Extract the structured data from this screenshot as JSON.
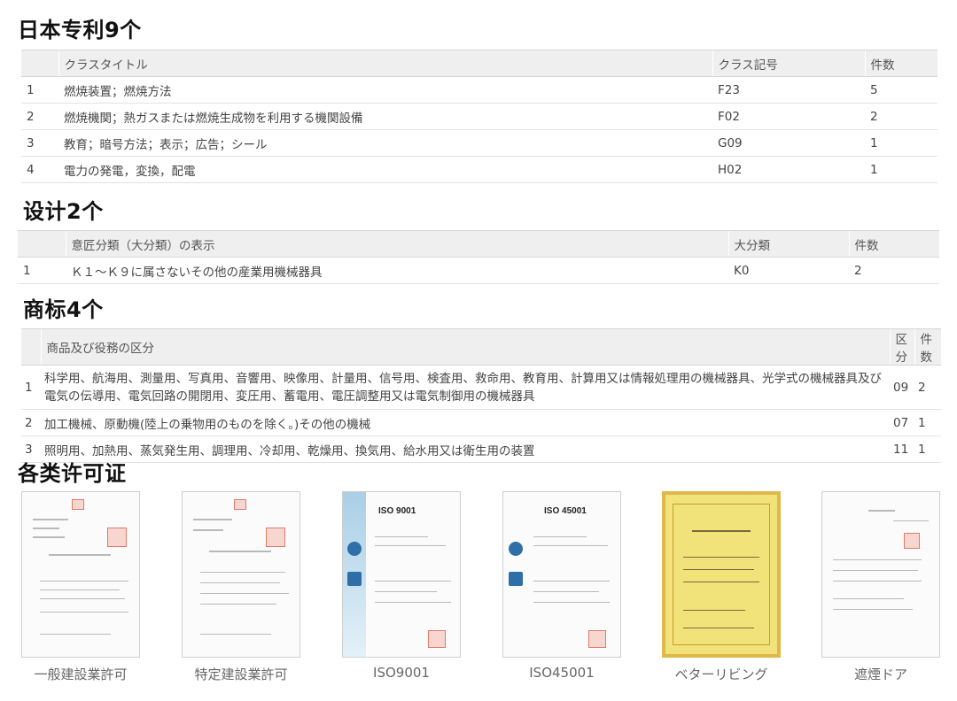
{
  "sections": {
    "patents_title": "日本专利9个",
    "designs_title": "设计2个",
    "trademarks_title": "商标4个",
    "licenses_title": "各类许可证"
  },
  "patents": {
    "headers": [
      "",
      "クラスタイトル",
      "クラス記号",
      "件数"
    ],
    "rows": [
      [
        "1",
        "燃焼装置；燃焼方法",
        "F23",
        "5"
      ],
      [
        "2",
        "燃焼機関；熱ガスまたは燃焼生成物を利用する機関設備",
        "F02",
        "2"
      ],
      [
        "3",
        "教育；暗号方法；表示；広告；シール",
        "G09",
        "1"
      ],
      [
        "4",
        "電力の発電，変換，配電",
        "H02",
        "1"
      ]
    ]
  },
  "designs": {
    "headers": [
      "",
      "意匠分類（大分類）の表示",
      "大分類",
      "件数"
    ],
    "rows": [
      [
        "1",
        "Ｋ１～Ｋ９に属さないその他の産業用機械器具",
        "K0",
        "2"
      ]
    ]
  },
  "trademarks": {
    "headers": [
      "",
      "商品及び役務の区分",
      "区分",
      "件数"
    ],
    "rows": [
      [
        "1",
        "科学用、航海用、測量用、写真用、音響用、映像用、計量用、信号用、検査用、救命用、教育用、計算用又は情報処理用の機械器具、光学式の機械器具及び電気の伝導用、電気回路の開閉用、変圧用、蓄電用、電圧調整用又は電気制御用の機械器具",
        "09",
        "2"
      ],
      [
        "2",
        "加工機械、原動機(陸上の乗物用のものを除く。)その他の機械",
        "07",
        "1"
      ],
      [
        "3",
        "照明用、加熱用、蒸気発生用、調理用、冷却用、乾燥用、換気用、給水用又は衛生用の装置",
        "11",
        "1"
      ]
    ]
  },
  "licenses": [
    {
      "caption": "一般建設業許可",
      "style": "plain"
    },
    {
      "caption": "特定建設業許可",
      "style": "plain"
    },
    {
      "caption": "ISO9001",
      "style": "iso",
      "head": "ISO 9001"
    },
    {
      "caption": "ISO45001",
      "style": "iso",
      "head": "ISO 45001"
    },
    {
      "caption": "ベターリビング",
      "style": "gold"
    },
    {
      "caption": "遮煙ドア",
      "style": "plain"
    }
  ]
}
